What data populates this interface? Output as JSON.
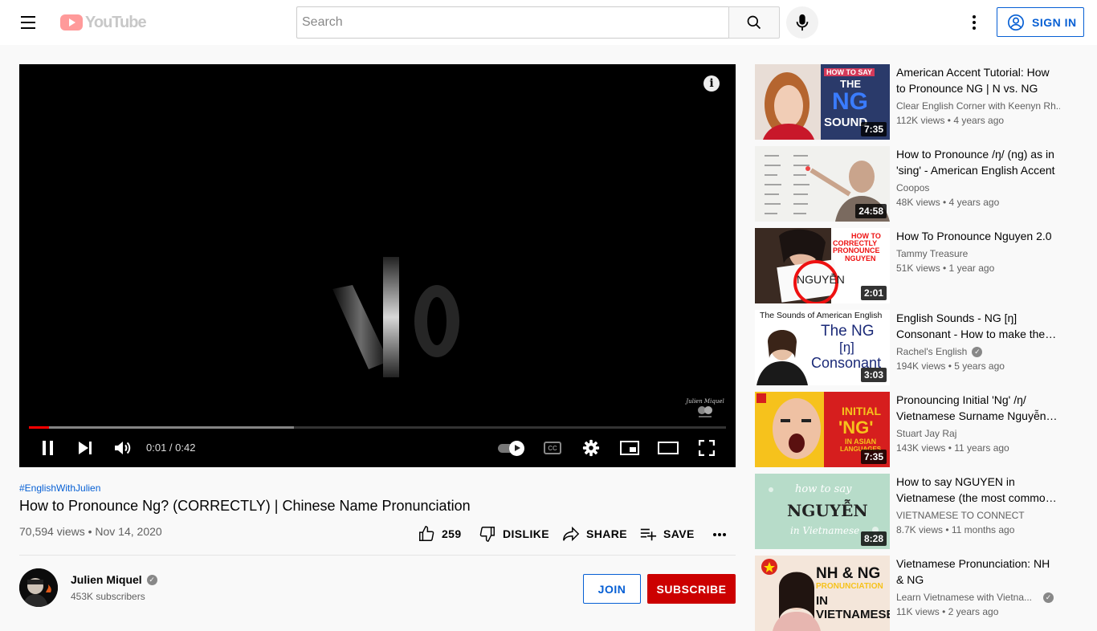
{
  "header": {
    "logo_text": "YouTube",
    "search_placeholder": "Search",
    "sign_in_label": "SIGN IN"
  },
  "player": {
    "time_display": "0:01 / 0:42",
    "progress_fraction": 0.029,
    "buffer_fraction": 0.38,
    "info_label": "i",
    "cc_label": "CC"
  },
  "video": {
    "hashtag": "#EnglishWithJulien",
    "title": "How to Pronounce Ng? (CORRECTLY) | Chinese Name Pronunciation",
    "views_date": "70,594 views • Nov 14, 2020",
    "like_count": "259",
    "dislike_label": "DISLIKE",
    "share_label": "SHARE",
    "save_label": "SAVE"
  },
  "channel": {
    "name": "Julien Miquel",
    "subscribers": "453K subscribers",
    "join_label": "JOIN",
    "subscribe_label": "SUBSCRIBE"
  },
  "recommendations": [
    {
      "title": "American Accent Tutorial: How to Pronounce NG | N vs. NG",
      "channel": "Clear English Corner with Keenyn Rh...",
      "verified": false,
      "meta": "112K views • 4 years ago",
      "duration": "7:35",
      "thumb_text": [
        "HOW TO SAY",
        "THE",
        "NG",
        "SOUND"
      ]
    },
    {
      "title": "How to Pronounce /ŋ/ (ng) as in 'sing' - American English Accent",
      "channel": "Coopos",
      "verified": false,
      "meta": "48K views • 4 years ago",
      "duration": "24:58",
      "thumb_text": []
    },
    {
      "title": "How To Pronounce Nguyen 2.0",
      "channel": "Tammy Treasure",
      "verified": false,
      "meta": "51K views • 1 year ago",
      "duration": "2:01",
      "thumb_text": [
        "HOW TO",
        "CORRECTLY",
        "PRONOUNCE",
        "NGUYEN",
        "NGUYỄN"
      ]
    },
    {
      "title": "English Sounds - NG [ŋ] Consonant - How to make the NG Consonant",
      "channel": "Rachel's English",
      "verified": true,
      "meta": "194K views • 5 years ago",
      "duration": "3:03",
      "thumb_text": [
        "The Sounds of American English",
        "The NG",
        "[ŋ]",
        "Consonant"
      ]
    },
    {
      "title": "Pronouncing Initial 'Ng' /ŋ/ Vietnamese Surname Nguyễn, Nguyen",
      "channel": "Stuart Jay Raj",
      "verified": false,
      "meta": "143K views • 11 years ago",
      "duration": "7:35",
      "thumb_text": [
        "INITIAL",
        "'NG'",
        "IN ASIAN",
        "LANGUAGES"
      ]
    },
    {
      "title": "How to say NGUYEN in Vietnamese (the most common surname)",
      "channel": "VIETNAMESE TO CONNECT",
      "verified": false,
      "meta": "8.7K views • 11 months ago",
      "duration": "8:28",
      "thumb_text": [
        "how to say",
        "NGUYỄN",
        "in Vietnamese"
      ]
    },
    {
      "title": "Vietnamese Pronunciation: NH & NG",
      "channel": "Learn Vietnamese with Vietna...",
      "verified": true,
      "meta": "11K views • 2 years ago",
      "duration": "",
      "thumb_text": [
        "NH & NG",
        "PRONUNCIATION",
        "IN VIETNAMESE"
      ]
    }
  ],
  "colors": {
    "accent_blue": "#065fd4",
    "subscribe_red": "#cc0000",
    "progress_red": "#ff0000"
  }
}
